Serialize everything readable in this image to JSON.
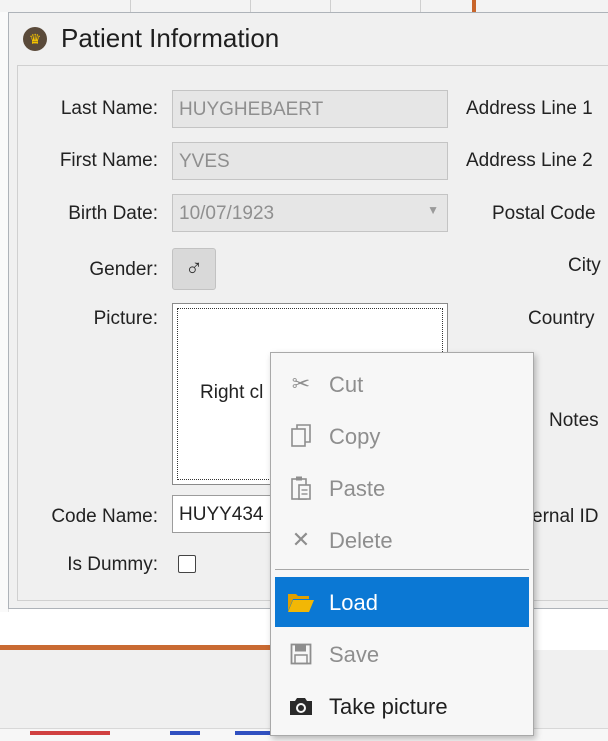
{
  "dialog": {
    "title": "Patient Information",
    "app_icon": "crown-icon"
  },
  "form": {
    "last_name": {
      "label": "Last Name:",
      "value": "HUYGHEBAERT"
    },
    "first_name": {
      "label": "First Name:",
      "value": "YVES"
    },
    "birth_date": {
      "label": "Birth Date:",
      "value": "10/07/1923"
    },
    "gender": {
      "label": "Gender:",
      "icon": "male-symbol-icon",
      "glyph": "♂"
    },
    "picture": {
      "label": "Picture:",
      "hint": "Right cl"
    },
    "code_name": {
      "label": "Code Name:",
      "value": "HUYY434"
    },
    "is_dummy": {
      "label": "Is Dummy:",
      "checked": false
    }
  },
  "right_labels": {
    "address1": "Address Line 1",
    "address2": "Address Line 2",
    "postal_code": "Postal Code",
    "city": "City",
    "country": "Country",
    "notes": "Notes",
    "external_id": "ernal ID"
  },
  "context_menu": {
    "items": [
      {
        "label": "Cut",
        "icon": "scissors-icon",
        "enabled": false
      },
      {
        "label": "Copy",
        "icon": "copy-icon",
        "enabled": false
      },
      {
        "label": "Paste",
        "icon": "paste-icon",
        "enabled": false
      },
      {
        "label": "Delete",
        "icon": "delete-x-icon",
        "enabled": false
      },
      {
        "label": "Load",
        "icon": "folder-open-icon",
        "enabled": true,
        "selected": true
      },
      {
        "label": "Save",
        "icon": "floppy-disk-icon",
        "enabled": false
      },
      {
        "label": "Take picture",
        "icon": "camera-icon",
        "enabled": true
      }
    ]
  },
  "colors": {
    "selection": "#0b78d4",
    "accent_orange": "#c96a32",
    "folder_yellow": "#f2b705"
  }
}
